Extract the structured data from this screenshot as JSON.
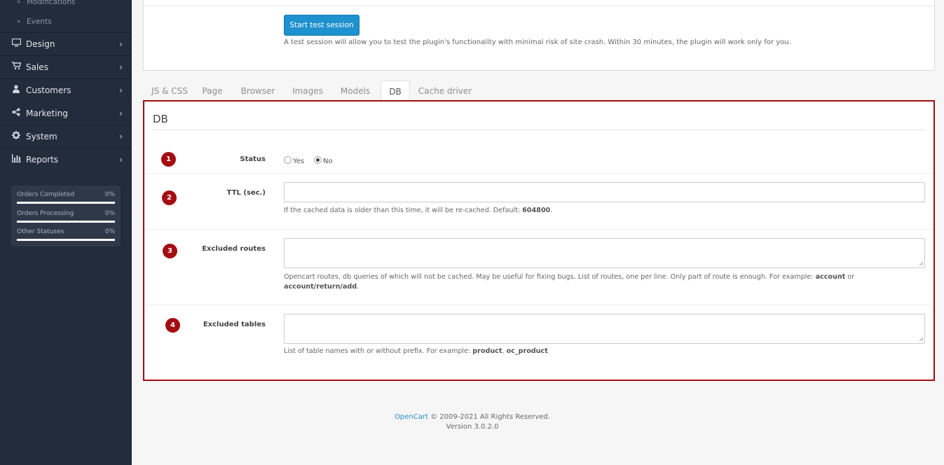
{
  "sidebar": {
    "sub_items": [
      {
        "label": "Modifications"
      },
      {
        "label": "Events"
      }
    ],
    "nav_items": [
      {
        "label": "Design",
        "icon": "monitor-icon"
      },
      {
        "label": "Sales",
        "icon": "cart-icon"
      },
      {
        "label": "Customers",
        "icon": "user-icon"
      },
      {
        "label": "Marketing",
        "icon": "share-icon"
      },
      {
        "label": "System",
        "icon": "gear-icon"
      },
      {
        "label": "Reports",
        "icon": "bar-chart-icon"
      }
    ],
    "stats": [
      {
        "label": "Orders Completed",
        "value": "0%",
        "percent": 0
      },
      {
        "label": "Orders Processing",
        "value": "0%",
        "percent": 0
      },
      {
        "label": "Other Statuses",
        "value": "0%",
        "percent": 0
      }
    ]
  },
  "test_session": {
    "button_label": "Start test session",
    "help": "A test session will allow you to test the plugin's functionality with minimal risk of site crash. Within 30 minutes, the plugin will work only for you."
  },
  "tabs": [
    {
      "label": "JS & CSS"
    },
    {
      "label": "Page"
    },
    {
      "label": "Browser"
    },
    {
      "label": "Images"
    },
    {
      "label": "Models"
    },
    {
      "label": "DB",
      "active": true
    },
    {
      "label": "Cache driver"
    }
  ],
  "db": {
    "title": "DB",
    "status": {
      "badge": "1",
      "label": "Status",
      "options": [
        "Yes",
        "No"
      ],
      "selected": "No"
    },
    "ttl": {
      "badge": "2",
      "label": "TTL (sec.)",
      "value": "",
      "help_text": "If the cached data is older than this time, it will be re-cached. Default: ",
      "help_default": "604800",
      "help_end": "."
    },
    "excluded_routes": {
      "badge": "3",
      "label": "Excluded routes",
      "value": "",
      "help_text": "Opencart routes, db queries of which will not be cached. May be useful for fixing bugs. List of routes, one per line. Only part of route is enough. For example: ",
      "help_ex1": "account",
      "help_or": " or",
      "help_ex2": "account/return/add",
      "help_end": "."
    },
    "excluded_tables": {
      "badge": "4",
      "label": "Excluded tables",
      "value": "",
      "help_text": "List of table names with or without prefix. For example: ",
      "help_ex1": "product",
      "help_sep": ", ",
      "help_ex2": "oc_product"
    }
  },
  "footer": {
    "link": "OpenCart",
    "copyright": " © 2009-2021 All Rights Reserved.",
    "version": "Version 3.0.2.0"
  },
  "colors": {
    "sidebar_bg": "#222c3c",
    "accent": "#1e91cf",
    "highlight": "#a30d12"
  }
}
